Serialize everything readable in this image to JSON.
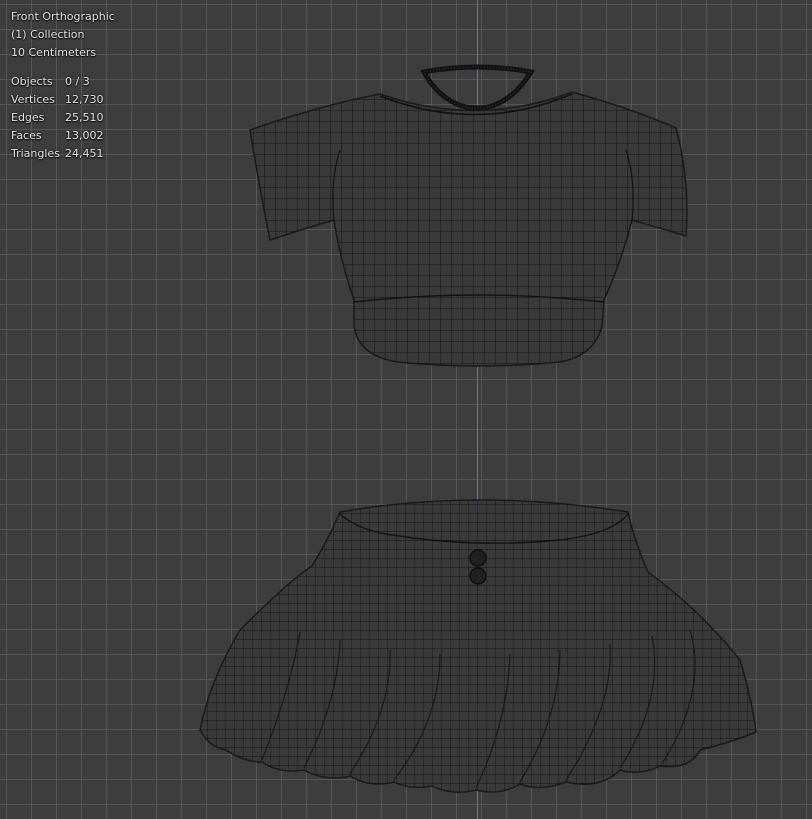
{
  "viewport": {
    "view_name": "Front Orthographic",
    "collection": "(1) Collection",
    "scale": "10 Centimeters",
    "stats": [
      {
        "label": "Objects",
        "value": "0 / 3"
      },
      {
        "label": "Vertices",
        "value": "12,730"
      },
      {
        "label": "Edges",
        "value": "25,510"
      },
      {
        "label": "Faces",
        "value": "13,002"
      },
      {
        "label": "Triangles",
        "value": "24,451"
      }
    ]
  },
  "colors": {
    "background": "#3d3d3d",
    "grid": "#5f5f5f",
    "z_axis": "#4a7fc0",
    "mesh_fill": "#3a3a3a",
    "wire": "#151515"
  }
}
